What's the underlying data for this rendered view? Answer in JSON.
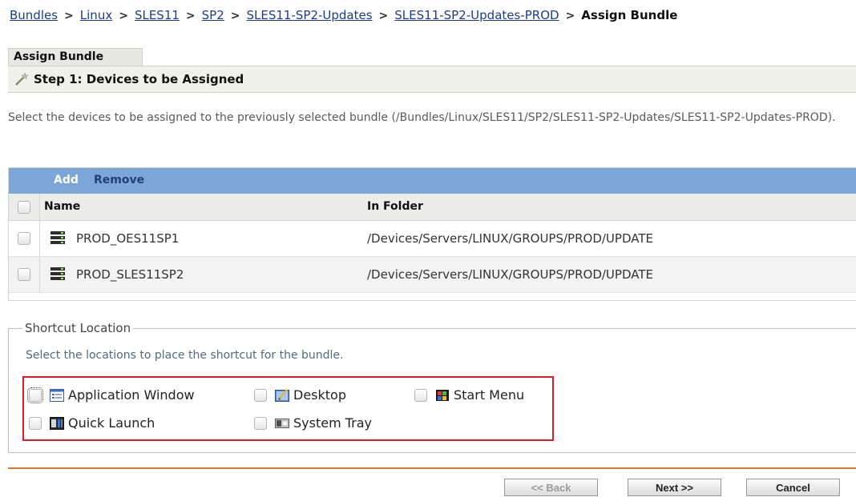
{
  "breadcrumb": {
    "items": [
      "Bundles",
      "Linux",
      "SLES11",
      "SP2",
      "SLES11-SP2-Updates",
      "SLES11-SP2-Updates-PROD"
    ],
    "current": "Assign Bundle"
  },
  "wizard": {
    "tab_label": "Assign Bundle",
    "step_title": "Step 1: Devices to be Assigned",
    "description": "Select the devices to be assigned to the previously selected bundle (/Bundles/Linux/SLES11/SP2/SLES11-SP2-Updates/SLES11-SP2-Updates-PROD)."
  },
  "devices": {
    "actions": {
      "add": "Add",
      "remove": "Remove"
    },
    "columns": {
      "name": "Name",
      "folder": "In Folder"
    },
    "rows": [
      {
        "name": "PROD_OES11SP1",
        "folder": "/Devices/Servers/LINUX/GROUPS/PROD/UPDATE"
      },
      {
        "name": "PROD_SLES11SP2",
        "folder": "/Devices/Servers/LINUX/GROUPS/PROD/UPDATE"
      }
    ]
  },
  "shortcut": {
    "legend": "Shortcut Location",
    "description": "Select the locations to place the shortcut for the bundle.",
    "options": {
      "application_window": "Application Window",
      "desktop": "Desktop",
      "start_menu": "Start Menu",
      "quick_launch": "Quick Launch",
      "system_tray": "System Tray"
    }
  },
  "buttons": {
    "back": "<< Back",
    "next": "Next >>",
    "cancel": "Cancel"
  },
  "colors": {
    "link": "#1a3e8c",
    "toolbar": "#7da6d8",
    "highlight_box": "#e41b23",
    "divider": "#e2762e"
  }
}
